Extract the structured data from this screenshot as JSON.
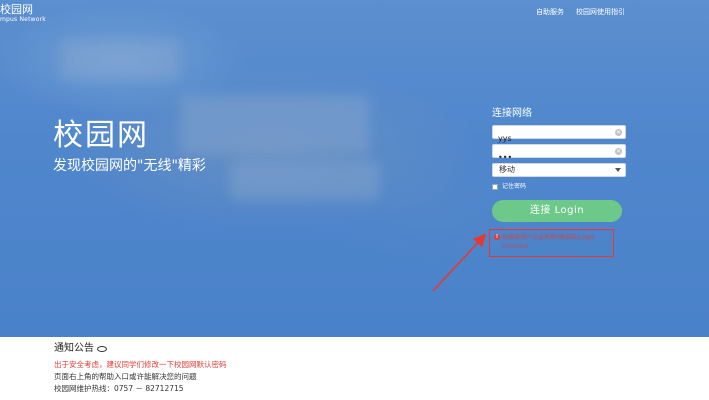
{
  "header": {
    "logo_title": "校园网",
    "logo_subtitle": "mpus  Network",
    "links": [
      "自助服务",
      "校园网使用指引"
    ]
  },
  "hero": {
    "title": "校园网",
    "subtitle": "发现校园网的\"无线\"精彩"
  },
  "login": {
    "title": "连接网络",
    "username_value": "yys",
    "password_value": "•••",
    "carrier_selected": "移动",
    "remember_label": "记住密码",
    "remember_checked": false,
    "button_label": "连接 Login",
    "error_text": "运营商用户认证失败(错误码)Login incorrect",
    "accent_color": "#6cc98a",
    "error_color": "#e53935"
  },
  "notice": {
    "title": "通知公告",
    "lines": [
      "出于安全考虑，建议同学们修改一下校园网默认密码",
      "页面右上角的帮助入口或许能解决您的问题",
      "校园网维护热线：0757 － 82712715"
    ]
  }
}
